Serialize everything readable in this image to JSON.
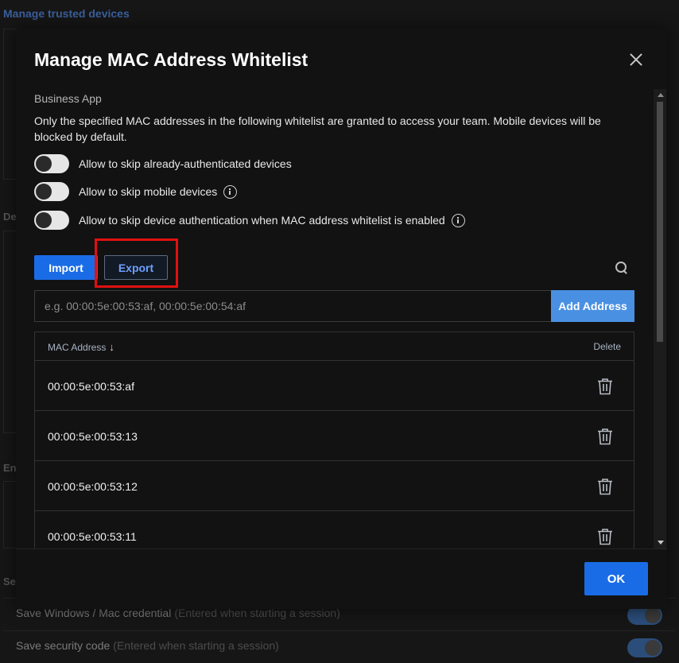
{
  "background": {
    "title": "Manage trusted devices",
    "side_labels": [
      "De",
      "En",
      "Se"
    ],
    "rows": [
      {
        "label": "Save Windows / Mac credential",
        "hint": "(Entered when starting a session)"
      },
      {
        "label": "Save security code",
        "hint": "(Entered when starting a session)"
      }
    ]
  },
  "modal": {
    "title": "Manage MAC Address Whitelist",
    "section_label": "Business App",
    "description": "Only the specified MAC addresses in the following whitelist are granted to access your team. Mobile devices will be blocked by default.",
    "toggles": [
      {
        "label": "Allow to skip already-authenticated devices",
        "on": false,
        "info": false
      },
      {
        "label": "Allow to skip mobile devices",
        "on": false,
        "info": true
      },
      {
        "label": "Allow to skip device authentication when MAC address whitelist is enabled",
        "on": false,
        "info": true
      }
    ],
    "import_label": "Import",
    "export_label": "Export",
    "input_placeholder": "e.g. 00:00:5e:00:53:af, 00:00:5e:00:54:af",
    "add_label": "Add Address",
    "table": {
      "col_mac": "MAC Address",
      "sort_glyph": "↓",
      "col_delete": "Delete",
      "rows": [
        "00:00:5e:00:53:af",
        "00:00:5e:00:53:13",
        "00:00:5e:00:53:12",
        "00:00:5e:00:53:11"
      ]
    },
    "ok_label": "OK"
  },
  "icons": [
    "close-icon",
    "info-icon",
    "search-icon",
    "trash-icon",
    "sort-down-icon"
  ],
  "colors": {
    "primary": "#1a6ce6",
    "add_button": "#4a90e2",
    "highlight": "#e01010",
    "export_text": "#6ea0ff"
  }
}
